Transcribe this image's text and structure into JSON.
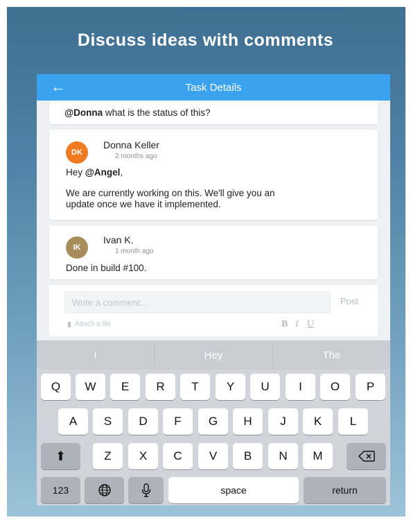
{
  "headline": "Discuss ideas with comments",
  "app_bar": {
    "title": "Task Details",
    "back_icon": "arrow-left-icon"
  },
  "comments": [
    {
      "mention": "@Donna",
      "text_after": " what is the status of this?"
    },
    {
      "initials": "DK",
      "avatar_color": "#f07a1f",
      "author": "Donna Keller",
      "time": "2 months ago",
      "greeting_before": "Hey ",
      "greeting_mention": "@Angel",
      "greeting_after": ",",
      "body_line1": "We are currently working on this. We'll give you an",
      "body_line2": "update once we have it implemented."
    },
    {
      "initials": "IK",
      "avatar_color": "#a88c5a",
      "author": "Ivan K.",
      "time": "1 month ago",
      "body": "Done in build #100."
    }
  ],
  "composer": {
    "placeholder": "Write a comment...",
    "post_label": "Post",
    "attach_label": "Attach a file",
    "attach_icon": "paperclip-icon",
    "format_bold": "B",
    "format_italic": "I",
    "format_underline": "U"
  },
  "keyboard": {
    "suggestions": [
      "I",
      "Hey",
      "The"
    ],
    "row1": [
      "Q",
      "W",
      "E",
      "R",
      "T",
      "Y",
      "U",
      "I",
      "O",
      "P"
    ],
    "row2": [
      "A",
      "S",
      "D",
      "F",
      "G",
      "H",
      "J",
      "K",
      "L"
    ],
    "row3": [
      "Z",
      "X",
      "C",
      "V",
      "B",
      "N",
      "M"
    ],
    "numbers_label": "123",
    "space_label": "space",
    "return_label": "return",
    "shift_icon": "shift-icon",
    "backspace_icon": "backspace-icon",
    "globe_icon": "globe-icon",
    "mic_icon": "microphone-icon"
  }
}
